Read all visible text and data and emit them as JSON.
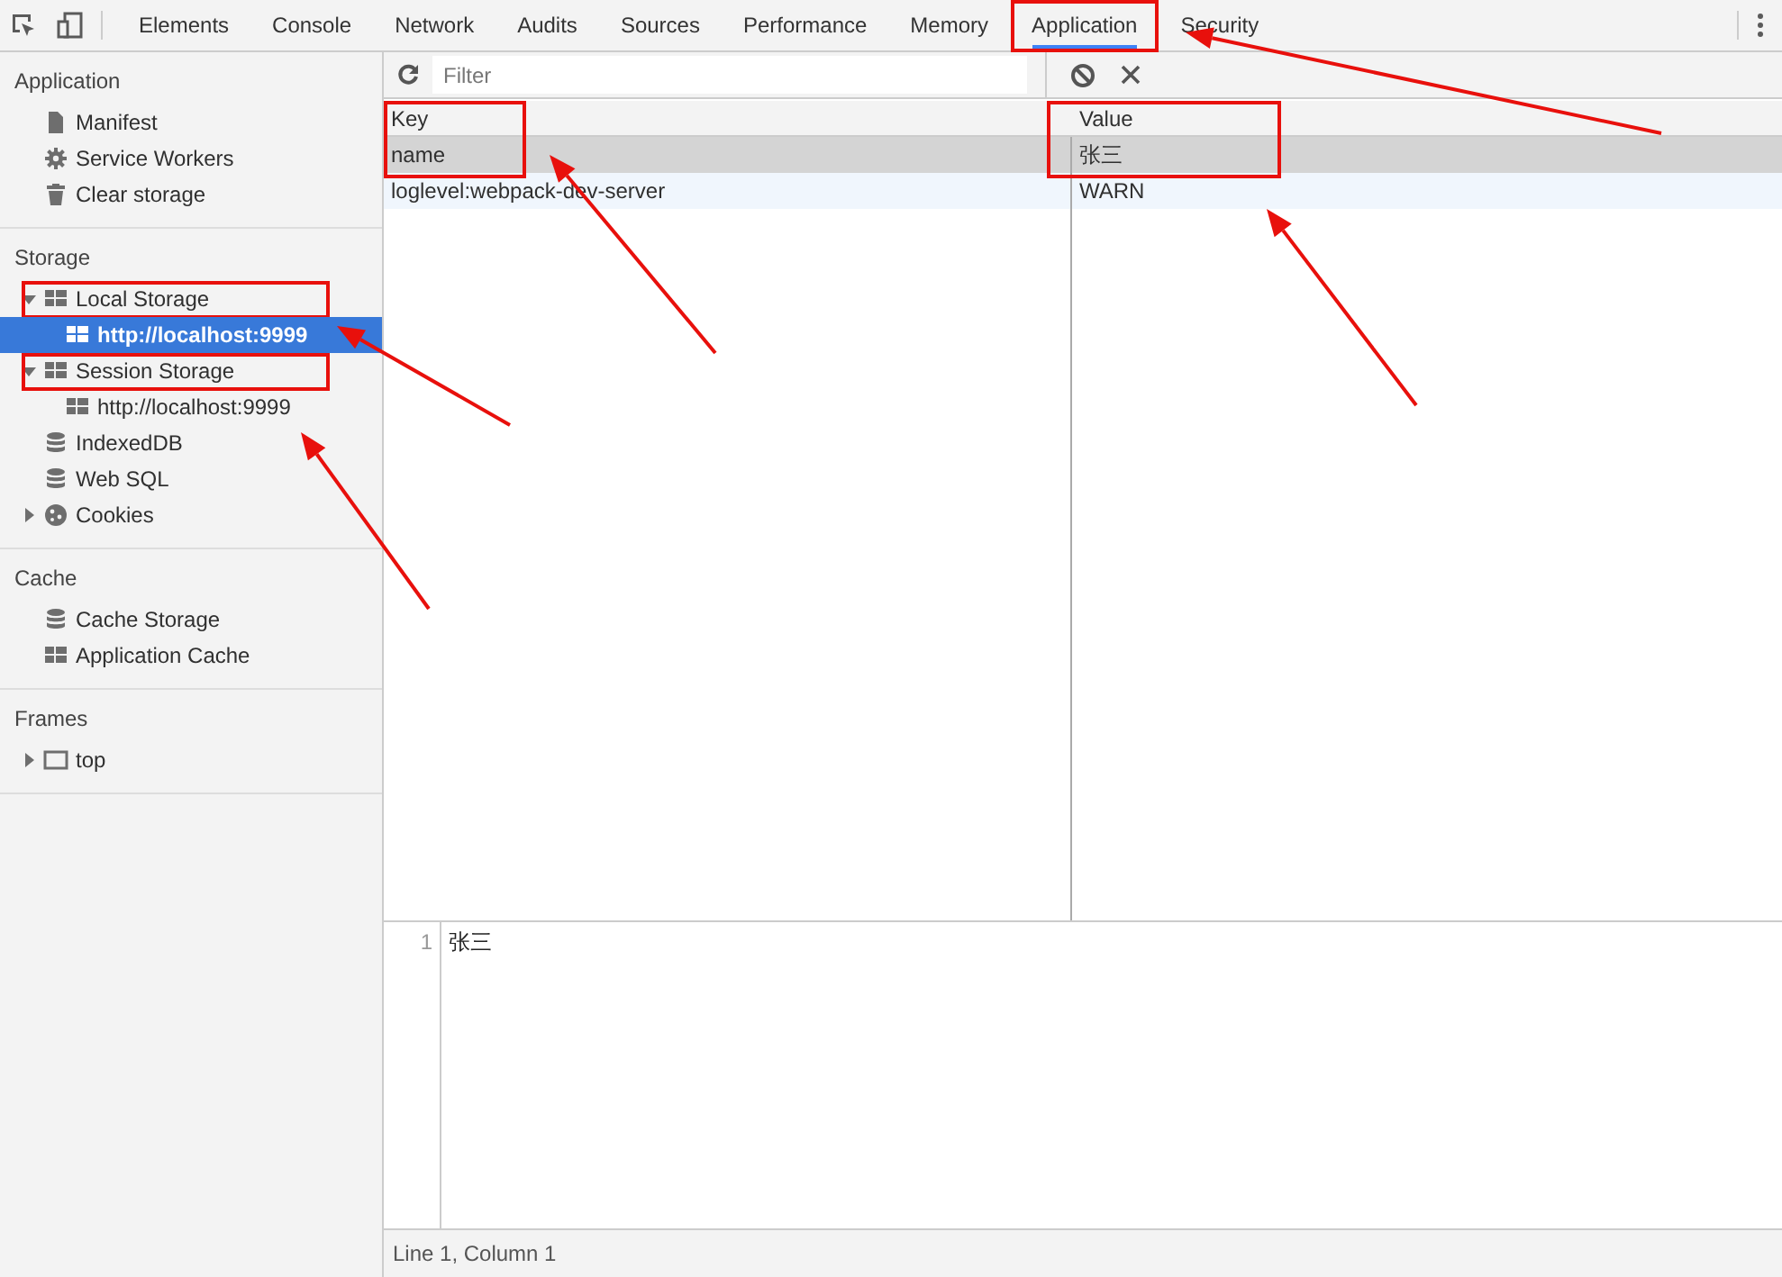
{
  "toolbar": {
    "tabs": [
      {
        "label": "Elements",
        "selected": false,
        "annotated": false
      },
      {
        "label": "Console",
        "selected": false,
        "annotated": false
      },
      {
        "label": "Network",
        "selected": false,
        "annotated": false
      },
      {
        "label": "Audits",
        "selected": false,
        "annotated": false
      },
      {
        "label": "Sources",
        "selected": false,
        "annotated": false
      },
      {
        "label": "Performance",
        "selected": false,
        "annotated": false
      },
      {
        "label": "Memory",
        "selected": false,
        "annotated": false
      },
      {
        "label": "Application",
        "selected": true,
        "annotated": true
      },
      {
        "label": "Security",
        "selected": false,
        "annotated": false
      }
    ]
  },
  "sidebar": {
    "sections": [
      {
        "title": "Application",
        "items": [
          {
            "label": "Manifest",
            "kind": "file",
            "selected": false,
            "annotated": false
          },
          {
            "label": "Service Workers",
            "kind": "gear",
            "selected": false,
            "annotated": false
          },
          {
            "label": "Clear storage",
            "kind": "trash",
            "selected": false,
            "annotated": false
          }
        ]
      },
      {
        "title": "Storage",
        "items": [
          {
            "label": "Local Storage",
            "kind": "grid",
            "selected": false,
            "annotated": true,
            "expanded": true,
            "children": [
              {
                "label": "http://localhost:9999",
                "kind": "grid",
                "selected": true,
                "annotated": false
              }
            ]
          },
          {
            "label": "Session Storage",
            "kind": "grid",
            "selected": false,
            "annotated": true,
            "expanded": true,
            "children": [
              {
                "label": "http://localhost:9999",
                "kind": "grid",
                "selected": false,
                "annotated": false
              }
            ]
          },
          {
            "label": "IndexedDB",
            "kind": "database",
            "selected": false,
            "annotated": false
          },
          {
            "label": "Web SQL",
            "kind": "database",
            "selected": false,
            "annotated": false
          },
          {
            "label": "Cookies",
            "kind": "cookie",
            "selected": false,
            "annotated": false,
            "expanded": false
          }
        ]
      },
      {
        "title": "Cache",
        "items": [
          {
            "label": "Cache Storage",
            "kind": "database",
            "selected": false,
            "annotated": false
          },
          {
            "label": "Application Cache",
            "kind": "grid",
            "selected": false,
            "annotated": false
          }
        ]
      },
      {
        "title": "Frames",
        "items": [
          {
            "label": "top",
            "kind": "frame",
            "selected": false,
            "annotated": false,
            "expanded": false
          }
        ]
      }
    ]
  },
  "storage_view": {
    "filter": {
      "placeholder": "Filter"
    },
    "table": {
      "columns": [
        {
          "label": "Key",
          "annotated": true
        },
        {
          "label": "Value",
          "annotated": true
        }
      ],
      "rows": [
        {
          "cells": [
            "name",
            "张三"
          ],
          "selected": true
        },
        {
          "cells": [
            "loglevel:webpack-dev-server",
            "WARN"
          ],
          "selected": false
        }
      ]
    },
    "editor": {
      "lines": [
        {
          "number": "1",
          "text": "张三"
        }
      ]
    },
    "status_bar": "Line 1, Column 1"
  },
  "annotation_arrows": true
}
